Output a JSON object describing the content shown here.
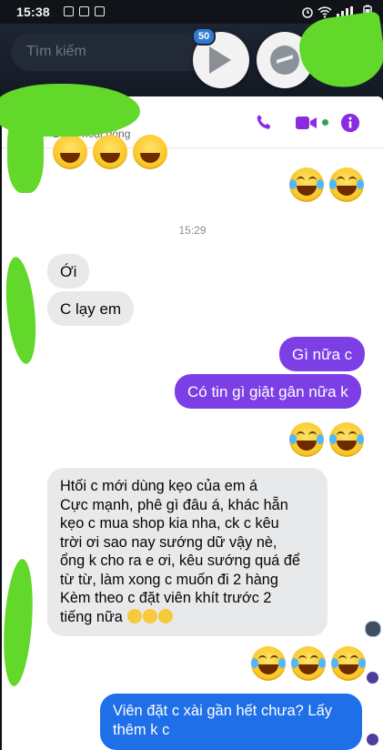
{
  "status_bar": {
    "time": "15:38",
    "notification_icons": [
      "image-icon",
      "gmail-icon",
      "app-icon"
    ],
    "right_icons": [
      "alarm-icon",
      "wifi-icon",
      "signal-icon",
      "battery-icon"
    ]
  },
  "search": {
    "placeholder": "Tìm kiếm"
  },
  "video_bubble": {
    "badge_count": "50"
  },
  "chat_header": {
    "active_status": "Đang hoạt động"
  },
  "chat": {
    "timestamp": "15:29",
    "incoming_1": [
      "Ới",
      "C lạy em"
    ],
    "outgoing_1": [
      "Gì nữa c",
      "Có tin gì giật gân nữa k"
    ],
    "incoming_2": {
      "lines": [
        "Htối c mới dùng kẹo của em á",
        "Cực mạnh, phê gì đâu á, khác hẵn",
        "kẹo c mua shop kia nha, ck c kêu",
        "trời ơi sao nay sướng dữ vậy nè,",
        "ổng k cho ra e ơi, kêu sướng quá để",
        "từ từ, làm xong c muốn đi 2 hàng",
        "Kèm theo c đặt viên khít trước 2",
        "tiếng nữa"
      ]
    },
    "outgoing_2": [
      "Viên đặt c xài gần hết chưa? Lấy",
      "thêm k c"
    ]
  },
  "colors": {
    "accent": "#8a2be2",
    "outgoing_purple": "#7c3fe6",
    "outgoing_blue": "#1f6fe8",
    "incoming_bg": "#e8e9eb",
    "censor_green": "#62d82a"
  }
}
